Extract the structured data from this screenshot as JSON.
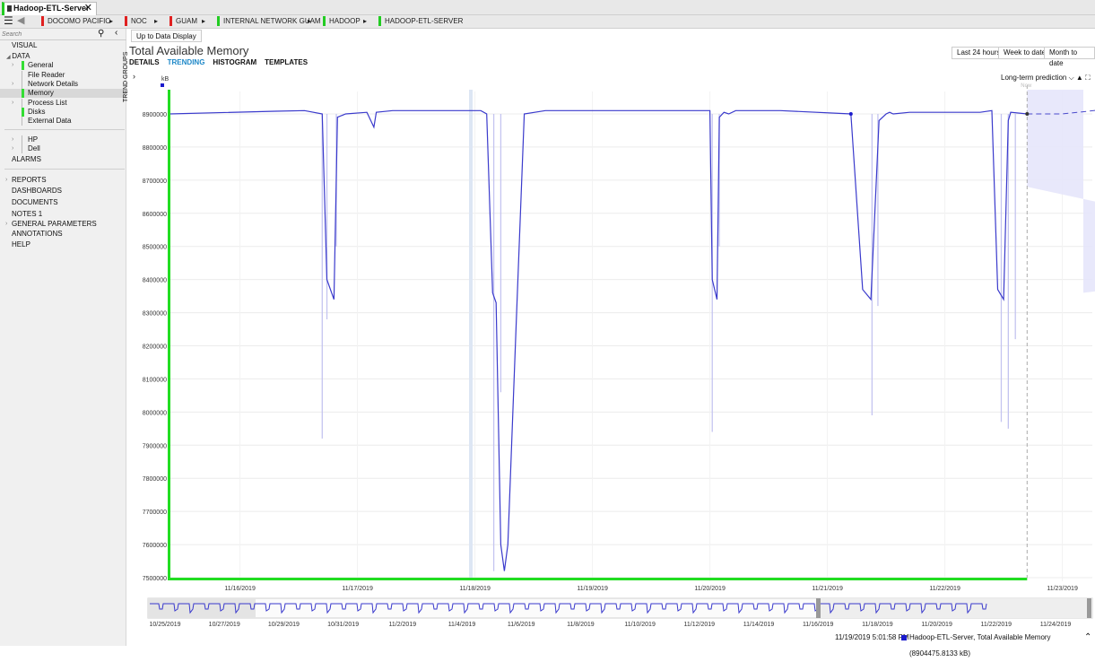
{
  "tab": {
    "title": "Hadoop-ETL-Server",
    "close": "✕"
  },
  "breadcrumbs": [
    {
      "label": "DOCOMO PACIFIC",
      "color": "#e02020"
    },
    {
      "label": "NOC",
      "color": "#e02020"
    },
    {
      "label": "GUAM",
      "color": "#e02020"
    },
    {
      "label": "INTERNAL NETWORK GUAM",
      "color": "#22cc22"
    },
    {
      "label": "HADOOP",
      "color": "#22cc22"
    },
    {
      "label": "HADOOP-ETL-SERVER",
      "color": "#22cc22"
    }
  ],
  "sidebar": {
    "search_placeholder": "Search",
    "visual": "VISUAL",
    "data": "DATA",
    "data_items": [
      "General",
      "File Reader",
      "Network Details",
      "Memory",
      "Process List",
      "Disks",
      "External Data"
    ],
    "hosts": [
      "HP",
      "Dell"
    ],
    "alarms": "ALARMS",
    "bottom_items": [
      "REPORTS",
      "DASHBOARDS",
      "DOCUMENTS",
      "NOTES",
      "GENERAL PARAMETERS",
      "ANNOTATIONS",
      "HELP"
    ],
    "notes_count": "1"
  },
  "main": {
    "up_to_data": "Up to Data Display",
    "title": "Total Available Memory",
    "subtabs": [
      "DETAILS",
      "TRENDING",
      "HISTOGRAM",
      "TEMPLATES"
    ],
    "range_buttons": [
      "Last 24 hours",
      "Week to date",
      "Month to date"
    ],
    "prediction": "Long-term prediction",
    "trend_groups": "TREND GROUPS",
    "now": "Now"
  },
  "colors": {
    "series": "#3a3acc",
    "prediction_band": "#e4e4fb",
    "active_tab": "#1e88c8",
    "green": "#22dd22"
  },
  "chart_data": {
    "type": "line",
    "unit": "kB",
    "ylim": [
      7500000,
      8900000
    ],
    "yticks": [
      "7500000",
      "7600000",
      "7700000",
      "7800000",
      "7900000",
      "8000000",
      "8100000",
      "8200000",
      "8300000",
      "8400000",
      "8500000",
      "8600000",
      "8700000",
      "8800000",
      "8900000"
    ],
    "xticks": [
      "11/16/2019",
      "11/17/2019",
      "11/18/2019",
      "11/19/2019",
      "11/20/2019",
      "11/21/2019",
      "11/22/2019",
      "11/23/2019"
    ],
    "series": [
      {
        "name": "Hadoop-ETL-Server, Total Available Memory"
      }
    ],
    "history": {
      "x": [
        0,
        0.9,
        1.15,
        1.3,
        1.34,
        1.4,
        1.43,
        1.5,
        1.68,
        1.74,
        1.76,
        1.9,
        2.65,
        2.7,
        2.75,
        2.78,
        2.82,
        2.85,
        2.88,
        2.95,
        3.02,
        3.2,
        3.5,
        4.6,
        4.62,
        4.66,
        4.68,
        4.72,
        4.76,
        4.82,
        5.2,
        5.8,
        5.9,
        5.97,
        6.04,
        6.1,
        6.13,
        6.16,
        6.3,
        6.9,
        7.0,
        7.05,
        7.1,
        7.14,
        7.16,
        7.3
      ],
      "y": [
        8900000,
        8908000,
        8910000,
        8900000,
        8400000,
        8340000,
        8890000,
        8900000,
        8905000,
        8860000,
        8905000,
        8910000,
        8910000,
        8900000,
        8360000,
        8330000,
        7600000,
        7520000,
        7600000,
        8260000,
        8900000,
        8910000,
        8910000,
        8910000,
        8400000,
        8340000,
        8890000,
        8905000,
        8900000,
        8910000,
        8910000,
        8900000,
        8370000,
        8340000,
        8880000,
        8900000,
        8905000,
        8900000,
        8905000,
        8905000,
        8910000,
        8370000,
        8340000,
        8880000,
        8905000,
        8900000
      ]
    },
    "prediction": {
      "x": [
        7.3,
        7.6,
        8.0,
        8.35,
        8.6,
        8.7,
        8.75,
        8.9,
        9.2,
        9.5,
        9.7,
        9.9,
        10.0,
        10.05,
        10.15,
        10.35,
        10.6,
        10.9,
        11.1
      ],
      "y": [
        8900000,
        8900000,
        8915000,
        8930000,
        8930000,
        8500000,
        8520000,
        8870000,
        8940000,
        8920000,
        8935000,
        8945000,
        8940000,
        8480000,
        8820000,
        8940000,
        8930000,
        8940000,
        8960000
      ]
    },
    "time_markers": {
      "now": "Now"
    }
  },
  "overview": {
    "xticks": [
      "10/25/2019",
      "10/27/2019",
      "10/29/2019",
      "10/31/2019",
      "11/2/2019",
      "11/4/2019",
      "11/6/2019",
      "11/8/2019",
      "11/10/2019",
      "11/12/2019",
      "11/14/2019",
      "11/16/2019",
      "11/18/2019",
      "11/20/2019",
      "11/22/2019",
      "11/24/2019"
    ]
  },
  "status": {
    "timestamp": "11/19/2019 5:01:58 PM",
    "legend": "Hadoop-ETL-Server, Total Available Memory (8904475.8133 kB)"
  }
}
